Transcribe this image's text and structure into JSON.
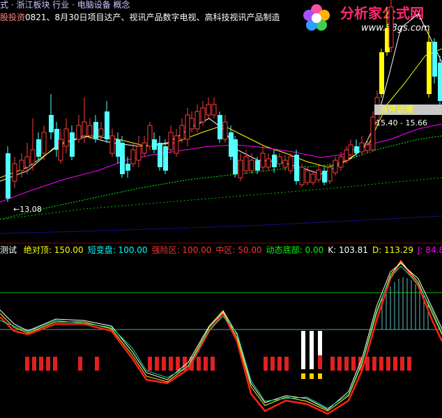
{
  "header": {
    "line1_text": "式 · 浙江板块    行业 · 电脑设备    概念",
    "line2_prefix": "股投资",
    "line2_text": "0821、8月30日项目达产、视讯产品数字电视、高科技视讯产品制造"
  },
  "logo": {
    "title": "分析家公式网",
    "url": "www.88gs.com"
  },
  "price_chart": {
    "tag_label": "涨停启爆",
    "range_label": "15.40 - 15.66",
    "low_label": "←13.08"
  },
  "indicator": {
    "name": "测试",
    "items": [
      {
        "label": "绝对顶:",
        "value": "150.00",
        "color": "#ffff00"
      },
      {
        "label": "短变盘:",
        "value": "100.00",
        "color": "#00ffff"
      },
      {
        "label": "强险区:",
        "value": "100.00",
        "color": "#ff3030"
      },
      {
        "label": "中区:",
        "value": "50.00",
        "color": "#ff3030"
      },
      {
        "label": "动态底部:",
        "value": "0.00",
        "color": "#00ff00"
      },
      {
        "label": "K:",
        "value": "103.81",
        "color": "#ffffff"
      },
      {
        "label": "D:",
        "value": "113.29",
        "color": "#ffff00"
      },
      {
        "label": "J:",
        "value": "84.87",
        "color": "#ff00ff"
      }
    ]
  },
  "colors": {
    "up_candle": "#ff3c3c",
    "down_candle": "#54ffff",
    "limit_up": "#ffff00",
    "ma_white": "#ffffff",
    "ma_yellow": "#ffff00",
    "ma_magenta": "#ff00ff",
    "ma_green": "#00ff00",
    "ma_blue": "#2020ff"
  }
}
